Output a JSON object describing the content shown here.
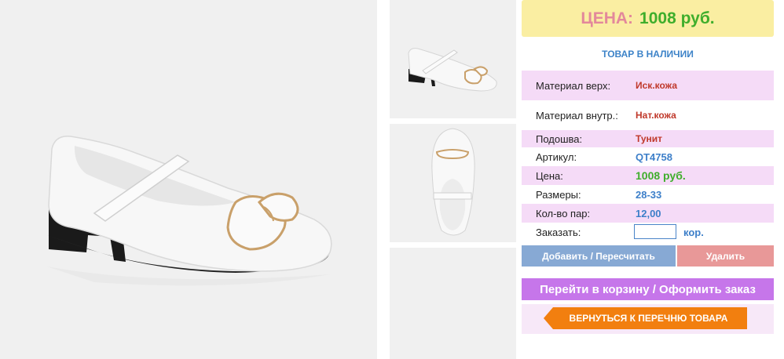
{
  "price": {
    "label": "ЦЕНА:",
    "value": "1008 руб."
  },
  "stock_status": "ТОВАР В НАЛИЧИИ",
  "specs": [
    {
      "label": "Материал верх:",
      "value": "Иск.кожа"
    },
    {
      "label": "Материал внутр.:",
      "value": "Нат.кожа"
    },
    {
      "label": "Подошва:",
      "value": "Тунит"
    },
    {
      "label": "Артикул:",
      "value": "QT4758"
    },
    {
      "label": "Цена:",
      "value": "1008 руб."
    },
    {
      "label": "Размеры:",
      "value": "28-33"
    },
    {
      "label": "Кол-во пар:",
      "value": "12,00"
    }
  ],
  "order": {
    "label": "Заказать:",
    "value": "",
    "unit": "кор."
  },
  "buttons": {
    "add": "Добавить / Пересчитать",
    "delete": "Удалить",
    "cart": "Перейти в корзину / Оформить заказ",
    "back": "ВЕРНУТЬСЯ К ПЕРЕЧНЮ ТОВАРА"
  },
  "colors": {
    "price_label": "#e3889b",
    "price_value": "#3fae2c",
    "accent_blue": "#3d83c8",
    "row_pink": "#f5dbf7",
    "cart_button": "#c676ea",
    "back_button": "#f27f0f"
  }
}
